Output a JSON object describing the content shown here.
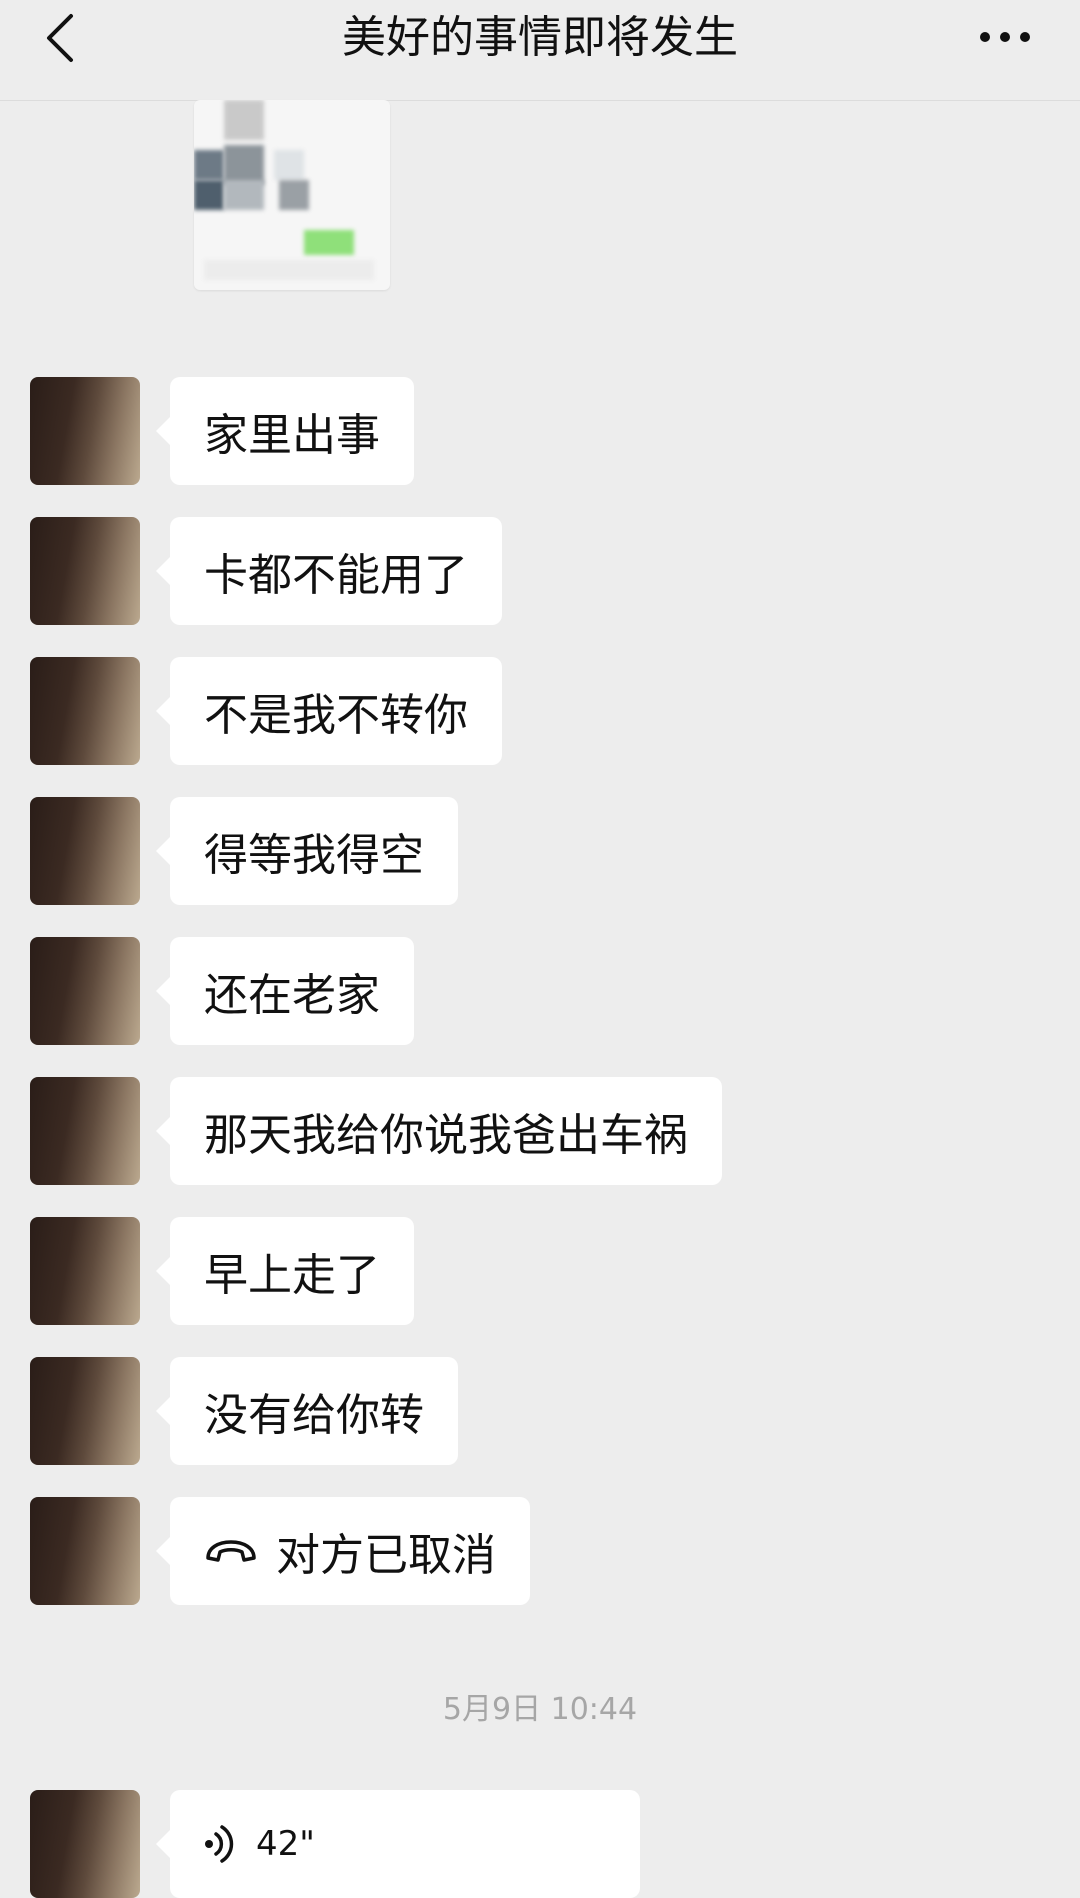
{
  "header": {
    "title": "美好的事情即将发生",
    "back_icon": "chevron-left-icon",
    "more_icon": "more-dots-icon"
  },
  "messages": [
    {
      "text": "家里出事"
    },
    {
      "text": "卡都不能用了"
    },
    {
      "text": "不是我不转你"
    },
    {
      "text": "得等我得空"
    },
    {
      "text": "还在老家"
    },
    {
      "text": "那天我给你说我爸出车祸"
    },
    {
      "text": "早上走了"
    },
    {
      "text": "没有给你转"
    },
    {
      "text": "对方已取消",
      "icon": "phone-hangup-icon"
    }
  ],
  "timestamp": "5月9日 10:44",
  "voice_message": {
    "duration": "42\"",
    "icon": "voice-wave-icon"
  },
  "colors": {
    "background": "#ededed",
    "bubble": "#ffffff",
    "timestamp": "#a6a6a6"
  }
}
